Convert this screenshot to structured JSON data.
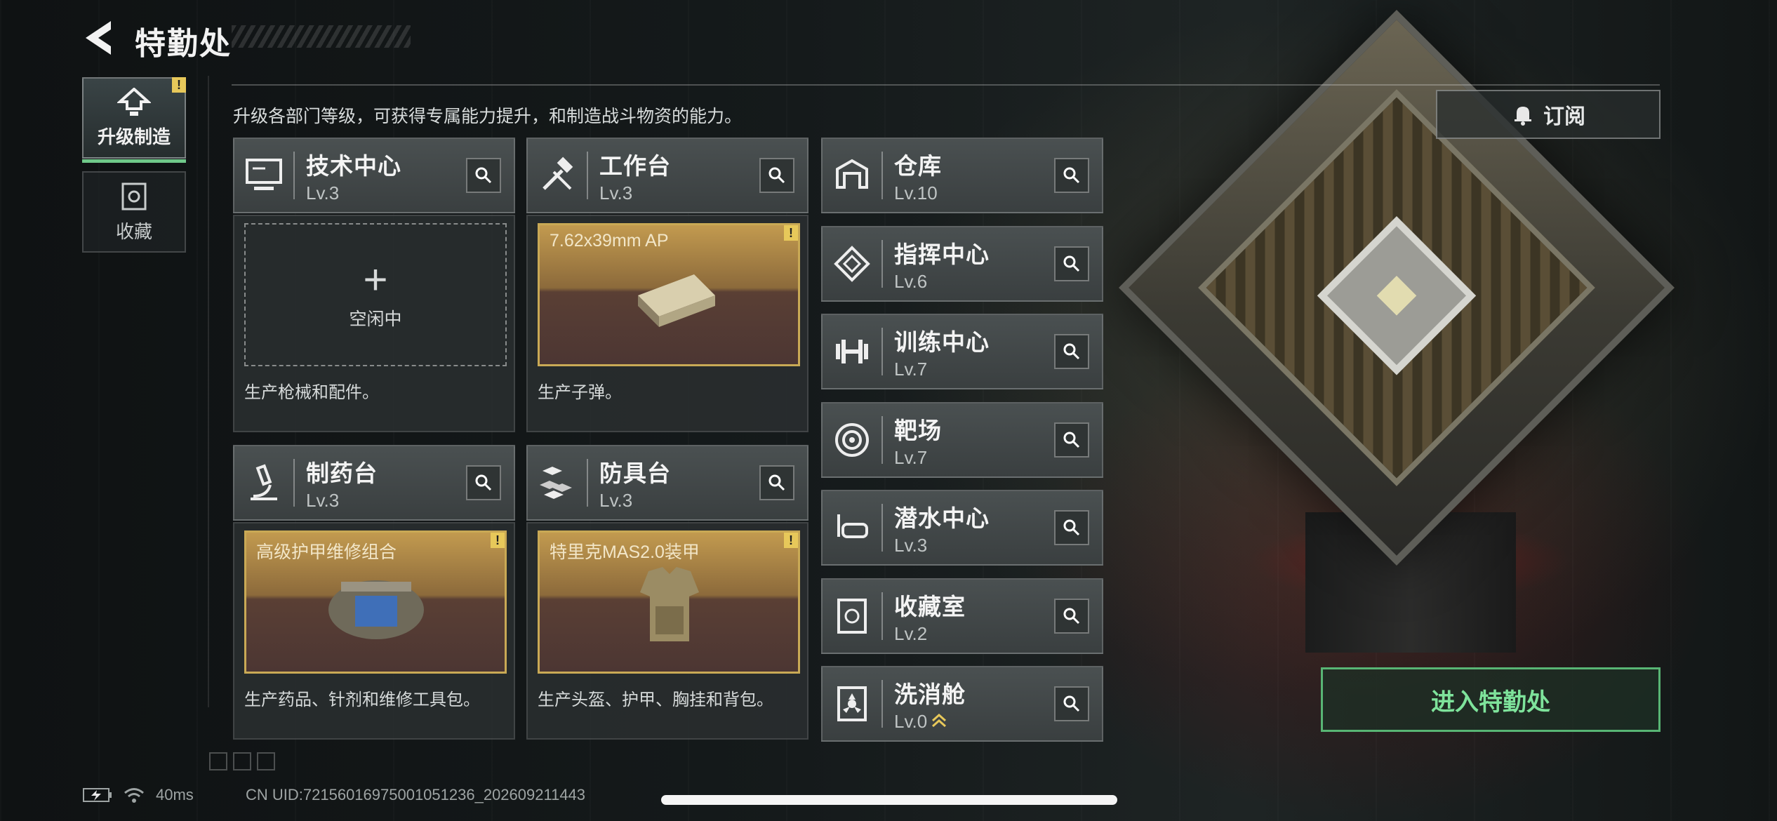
{
  "header": {
    "title": "特勤处"
  },
  "sidebar": {
    "tabs": [
      {
        "label": "升级制造",
        "active": true,
        "alert": "!"
      },
      {
        "label": "收藏",
        "active": false
      }
    ]
  },
  "description": "升级各部门等级，可获得专属能力提升，和制造战斗物资的能力。",
  "production_departments": [
    {
      "name": "技术中心",
      "level": "Lv.3",
      "slot_state": "empty",
      "slot_plus": "+",
      "slot_text": "空闲中",
      "body_text": "生产枪械和配件。"
    },
    {
      "name": "工作台",
      "level": "Lv.3",
      "slot_state": "item",
      "slot_text": "7.62x39mm AP",
      "alert": "!",
      "body_text": "生产子弹。"
    },
    {
      "name": "制药台",
      "level": "Lv.3",
      "slot_state": "item",
      "slot_text": "高级护甲维修组合",
      "alert": "!",
      "body_text": "生产药品、针剂和维修工具包。"
    },
    {
      "name": "防具台",
      "level": "Lv.3",
      "slot_state": "item",
      "slot_text": "特里克MAS2.0装甲",
      "alert": "!",
      "body_text": "生产头盔、护甲、胸挂和背包。"
    }
  ],
  "facilities": [
    {
      "name": "仓库",
      "level": "Lv.10",
      "icon": "warehouse-icon"
    },
    {
      "name": "指挥中心",
      "level": "Lv.6",
      "icon": "command-icon"
    },
    {
      "name": "训练中心",
      "level": "Lv.7",
      "icon": "dumbbell-icon"
    },
    {
      "name": "靶场",
      "level": "Lv.7",
      "icon": "target-icon"
    },
    {
      "name": "潜水中心",
      "level": "Lv.3",
      "icon": "diving-mask-icon"
    },
    {
      "name": "收藏室",
      "level": "Lv.2",
      "icon": "collection-icon"
    },
    {
      "name": "洗消舱",
      "level": "Lv.0",
      "icon": "decon-icon",
      "upgradable": true
    }
  ],
  "subscribe": {
    "label": "订阅"
  },
  "enter_button": {
    "label": "进入特勤处"
  },
  "status_bar": {
    "ping": "40ms",
    "uid": "CN UID:72156016975001051236_202609211443"
  },
  "colors": {
    "accent_green": "#58b574",
    "alert_yellow": "#e7c85a",
    "item_gold": "#c9a955"
  }
}
